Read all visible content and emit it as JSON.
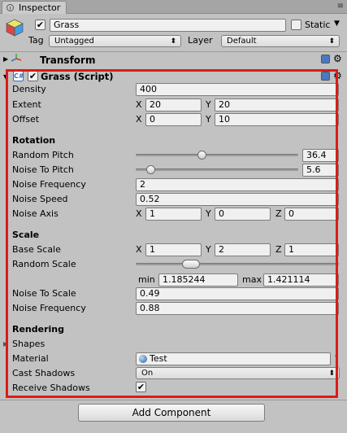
{
  "window": {
    "tab_title": "Inspector"
  },
  "object": {
    "active_checked": "✔",
    "name": "Grass",
    "static_label": "Static",
    "static_checked": "",
    "tag_label": "Tag",
    "tag_value": "Untagged",
    "layer_label": "Layer",
    "layer_value": "Default"
  },
  "components": {
    "transform": {
      "title": "Transform"
    },
    "grass": {
      "title": "Grass (Script)",
      "enabled_checked": "✔"
    }
  },
  "fields": {
    "density": {
      "label": "Density",
      "value": "400"
    },
    "extent": {
      "label": "Extent",
      "x_label": "X",
      "x": "20",
      "y_label": "Y",
      "y": "20"
    },
    "offset": {
      "label": "Offset",
      "x_label": "X",
      "x": "0",
      "y_label": "Y",
      "y": "10"
    },
    "rotation_header": "Rotation",
    "random_pitch": {
      "label": "Random Pitch",
      "value": "36.4",
      "slider_fraction": 0.4
    },
    "noise_to_pitch": {
      "label": "Noise To Pitch",
      "value": "5.6",
      "slider_fraction": 0.07
    },
    "noise_frequency": {
      "label": "Noise Frequency",
      "value": "2"
    },
    "noise_speed": {
      "label": "Noise Speed",
      "value": "0.52"
    },
    "noise_axis": {
      "label": "Noise Axis",
      "x_label": "X",
      "x": "1",
      "y_label": "Y",
      "y": "0",
      "z_label": "Z",
      "z": "0"
    },
    "scale_header": "Scale",
    "base_scale": {
      "label": "Base Scale",
      "x_label": "X",
      "x": "1",
      "y_label": "Y",
      "y": "2",
      "z_label": "Z",
      "z": "1"
    },
    "random_scale": {
      "label": "Random Scale",
      "min_label": "min",
      "min": "1.185244",
      "max_label": "max",
      "max": "1.421114"
    },
    "noise_to_scale": {
      "label": "Noise To Scale",
      "value": "0.49"
    },
    "noise_frequency_2": {
      "label": "Noise Frequency",
      "value": "0.88"
    },
    "rendering_header": "Rendering",
    "shapes": {
      "label": "Shapes"
    },
    "material": {
      "label": "Material",
      "value": "Test"
    },
    "cast_shadows": {
      "label": "Cast Shadows",
      "value": "On"
    },
    "receive_shadows": {
      "label": "Receive Shadows",
      "checked": "✔"
    }
  },
  "footer": {
    "add_component": "Add Component"
  },
  "colors": {
    "highlight_box": "#dd1a1a",
    "panel_bg": "#c2c2c2"
  }
}
